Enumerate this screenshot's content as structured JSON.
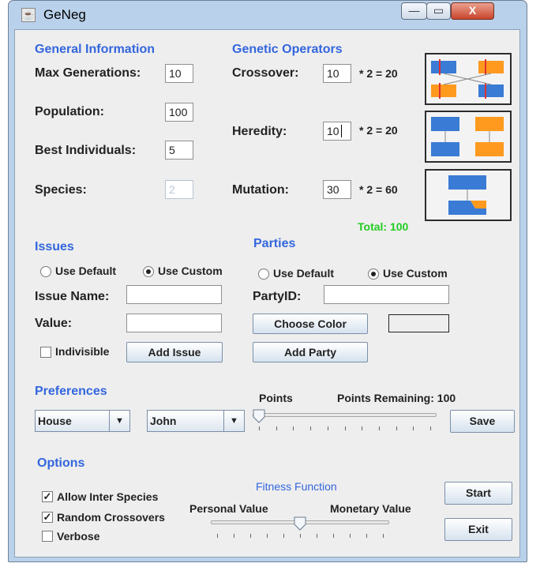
{
  "window": {
    "title": "GeNeg",
    "min_glyph": "—",
    "max_glyph": "▭",
    "close_glyph": "X"
  },
  "general": {
    "heading": "General Information",
    "max_generations": {
      "label": "Max Generations:",
      "value": "10"
    },
    "population": {
      "label": "Population:",
      "value": "100"
    },
    "best_individuals": {
      "label": "Best Individuals:",
      "value": "5"
    },
    "species": {
      "label": "Species:",
      "value": "2"
    }
  },
  "operators": {
    "heading": "Genetic Operators",
    "crossover": {
      "label": "Crossover:",
      "value": "10",
      "formula": "* 2 = 20"
    },
    "heredity": {
      "label": "Heredity:",
      "value": "10",
      "formula": "* 2 = 20"
    },
    "mutation": {
      "label": "Mutation:",
      "value": "30",
      "formula": "* 2 = 60"
    },
    "total": "Total: 100",
    "colors": {
      "blue": "#3a7bd5",
      "orange": "#ff9a1f",
      "total_green": "#22cc22"
    }
  },
  "issues": {
    "heading": "Issues",
    "use_default": "Use Default",
    "use_custom": "Use Custom",
    "selected": "custom",
    "name_label": "Issue Name:",
    "name_value": "",
    "value_label": "Value:",
    "value_value": "",
    "indivisible": "Indivisible",
    "indivisible_checked": false,
    "add_button": "Add Issue"
  },
  "parties": {
    "heading": "Parties",
    "use_default": "Use Default",
    "use_custom": "Use Custom",
    "selected": "custom",
    "id_label": "PartyID:",
    "id_value": "",
    "choose_color": "Choose Color",
    "add_button": "Add Party"
  },
  "preferences": {
    "heading": "Preferences",
    "issue_select": "House",
    "party_select": "John",
    "points_label": "Points",
    "points_remaining": "Points Remaining: 100",
    "points_value": 0,
    "save_button": "Save"
  },
  "options": {
    "heading": "Options",
    "allow_inter_species": {
      "label": "Allow Inter Species",
      "checked": true
    },
    "random_crossovers": {
      "label": "Random Crossovers",
      "checked": true
    },
    "verbose": {
      "label": "Verbose",
      "checked": false
    },
    "fitness_label": "Fitness Function",
    "personal_value": "Personal Value",
    "monetary_value": "Monetary Value",
    "fitness_slider_fraction": 0.5,
    "start_button": "Start",
    "exit_button": "Exit"
  }
}
